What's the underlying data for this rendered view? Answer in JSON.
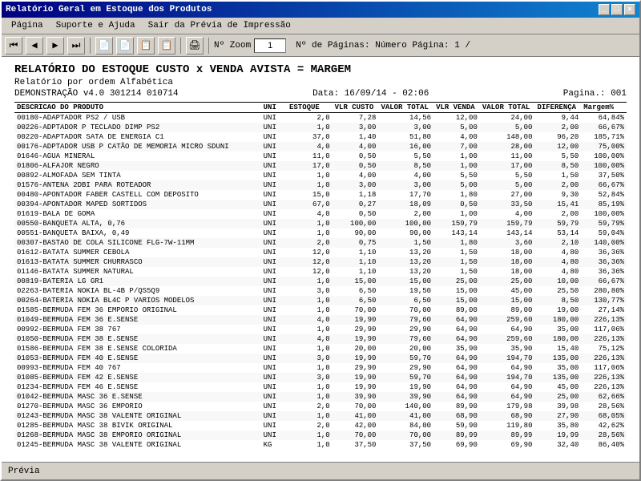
{
  "window": {
    "title": "Relatório Geral em Estoque dos Produtos"
  },
  "menu": {
    "items": [
      "Página",
      "Suporte e Ajuda",
      "Sair da Prévia de Impressão"
    ]
  },
  "toolbar": {
    "zoom_label": "Nº Zoom",
    "zoom_value": "1",
    "page_label": "Nº de Páginas: Número Página: 1 /"
  },
  "report": {
    "title": "RELATÓRIO DO ESTOQUE CUSTO x VENDA AVISTA = MARGEM",
    "subtitle": "Relatório por ordem Alfabética",
    "demo": "DEMONSTRAÇÃO v4.0 301214 010714",
    "date": "Data: 16/09/14 - 02:06",
    "page": "Pagina.: 001",
    "columns": [
      "DESCRICAO DO PRODUTO",
      "UNI",
      "ESTOQUE",
      "VLR CUSTO",
      "VALOR TOTAL",
      "VLR VENDA",
      "VALOR TOTAL",
      "DIFERENÇA",
      "Margem%"
    ],
    "rows": [
      [
        "00180-ADAPTADOR PS2 / USB",
        "UNI",
        "2,0",
        "7,28",
        "14,56",
        "12,00",
        "24,00",
        "9,44",
        "64,84%"
      ],
      [
        "00226-ADPTADOR P TECLADO DIMP PS2",
        "UNI",
        "1,0",
        "3,00",
        "3,00",
        "5,00",
        "5,00",
        "2,00",
        "66,67%"
      ],
      [
        "00220-ADAPTADOR SATA DE ENERGIA C1",
        "UNI",
        "37,0",
        "1,40",
        "51,80",
        "4,00",
        "148,00",
        "96,20",
        "185,71%"
      ],
      [
        "00176-ADPTADOR USB P CATÃO DE MEMORIA MICRO SDUNI",
        "UNI",
        "4,0",
        "4,00",
        "16,00",
        "7,00",
        "28,00",
        "12,00",
        "75,00%"
      ],
      [
        "01646-AGUA MINERAL",
        "UNI",
        "11,0",
        "0,50",
        "5,50",
        "1,00",
        "11,00",
        "5,50",
        "100,00%"
      ],
      [
        "01806-ALFAJOR NEGRO",
        "UNI",
        "17,0",
        "0,50",
        "8,50",
        "1,00",
        "17,00",
        "8,50",
        "100,00%"
      ],
      [
        "00892-ALMOFADA SEM TINTA",
        "UNI",
        "1,0",
        "4,00",
        "4,00",
        "5,50",
        "5,50",
        "1,50",
        "37,50%"
      ],
      [
        "01576-ANTENA 2DBI PARA ROTEADOR",
        "UNI",
        "1,0",
        "3,00",
        "3,00",
        "5,00",
        "5,00",
        "2,00",
        "66,67%"
      ],
      [
        "00480-APONTADOR FABER CASTELL COM DEPOSITO",
        "UNI",
        "15,0",
        "1,18",
        "17,70",
        "1,80",
        "27,00",
        "9,30",
        "52,84%"
      ],
      [
        "00394-APONTADOR MAPED SORTIDOS",
        "UNI",
        "67,0",
        "0,27",
        "18,09",
        "0,50",
        "33,50",
        "15,41",
        "85,19%"
      ],
      [
        "01619-BALA DE GOMA",
        "UNI",
        "4,0",
        "0,50",
        "2,00",
        "1,00",
        "4,00",
        "2,00",
        "100,00%"
      ],
      [
        "00550-BANQUETA ALTA, 0,76",
        "UNI",
        "1,0",
        "100,00",
        "100,00",
        "159,79",
        "159,79",
        "59,79",
        "59,79%"
      ],
      [
        "00551-BANQUETA BAIXA, 0,49",
        "UNI",
        "1,0",
        "90,00",
        "90,00",
        "143,14",
        "143,14",
        "53,14",
        "59,04%"
      ],
      [
        "00307-BASTAO DE COLA SILICONE FLG-7W-11MM",
        "UNI",
        "2,0",
        "0,75",
        "1,50",
        "1,80",
        "3,60",
        "2,10",
        "140,00%"
      ],
      [
        "01612-BATATA SUMMER CEBOLA",
        "UNI",
        "12,0",
        "1,10",
        "13,20",
        "1,50",
        "18,00",
        "4,80",
        "36,36%"
      ],
      [
        "01613-BATATA SUMMER CHURRASCO",
        "UNI",
        "12,0",
        "1,10",
        "13,20",
        "1,50",
        "18,00",
        "4,80",
        "36,36%"
      ],
      [
        "01146-BATATA SUMMER NATURAL",
        "UNI",
        "12,0",
        "1,10",
        "13,20",
        "1,50",
        "18,00",
        "4,80",
        "36,36%"
      ],
      [
        "00819-BATERIA LG GR1",
        "UNI",
        "1,0",
        "15,00",
        "15,00",
        "25,00",
        "25,00",
        "10,00",
        "66,67%"
      ],
      [
        "02263-BATERIA NOKIA BL-4B P/QS5Q9",
        "UNI",
        "3,0",
        "6,50",
        "19,50",
        "15,00",
        "45,00",
        "25,50",
        "280,80%"
      ],
      [
        "00264-BATERIA NOKIA BL4C P VARIOS MODELOS",
        "UNI",
        "1,0",
        "6,50",
        "6,50",
        "15,00",
        "15,00",
        "8,50",
        "130,77%"
      ],
      [
        "01585-BERMUDA FEM 36 EMPORIO ORIGINAL",
        "UNI",
        "1,0",
        "70,00",
        "70,00",
        "89,00",
        "89,00",
        "19,00",
        "27,14%"
      ],
      [
        "01049-BERMUDA FEM 36 E.SENSE",
        "UNI",
        "4,0",
        "19,90",
        "79,60",
        "64,90",
        "259,60",
        "180,00",
        "226,13%"
      ],
      [
        "00992-BERMUDA FEM 38  767",
        "UNI",
        "1,0",
        "29,90",
        "29,90",
        "64,90",
        "64,90",
        "35,00",
        "117,06%"
      ],
      [
        "01050-BERMUDA FEM 38 E.SENSE",
        "UNI",
        "4,0",
        "19,90",
        "79,60",
        "64,90",
        "259,60",
        "180,00",
        "226,13%"
      ],
      [
        "01586-BERMUDA FEM 38 E.SENSE COLORIDA",
        "UNI",
        "1,0",
        "20,00",
        "20,00",
        "35,90",
        "35,90",
        "15,40",
        "75,12%"
      ],
      [
        "01053-BERMUDA FEM 40 E.SENSE",
        "UNI",
        "3,0",
        "19,90",
        "59,70",
        "64,90",
        "194,70",
        "135,00",
        "226,13%"
      ],
      [
        "00993-BERMUDA FEM 40 767",
        "UNI",
        "1,0",
        "29,90",
        "29,90",
        "64,90",
        "64,90",
        "35,00",
        "117,06%"
      ],
      [
        "01085-BERMUDA FEM 42 E.SENSE",
        "UNI",
        "3,0",
        "19,90",
        "59,70",
        "64,90",
        "194,70",
        "135,00",
        "226,13%"
      ],
      [
        "01234-BERMUDA FEM 46 E.SENSE",
        "UNI",
        "1,0",
        "19,90",
        "19,90",
        "64,90",
        "64,90",
        "45,00",
        "226,13%"
      ],
      [
        "01042-BERMUDA MASC 36 E.SENSE",
        "UNI",
        "1,0",
        "39,90",
        "39,90",
        "64,90",
        "64,90",
        "25,00",
        "62,66%"
      ],
      [
        "01270-BERMUDA MASC 36 EMPORIO",
        "UNI",
        "2,0",
        "70,00",
        "140,00",
        "89,90",
        "179,98",
        "39,98",
        "28,56%"
      ],
      [
        "01243-BERMUDA MASC 38 VALENTE ORIGINAL",
        "UNI",
        "1,0",
        "41,00",
        "41,00",
        "68,90",
        "68,90",
        "27,90",
        "68,05%"
      ],
      [
        "01285-BERMUDA MASC 38 BIVIK ORIGINAL",
        "UNI",
        "2,0",
        "42,00",
        "84,00",
        "59,90",
        "119,80",
        "35,80",
        "42,62%"
      ],
      [
        "01268-BERMUDA MASC 38 EMPORIO ORIGINAL",
        "UNI",
        "1,0",
        "70,00",
        "70,00",
        "89,99",
        "89,99",
        "19,99",
        "28,56%"
      ],
      [
        "01245-BERMUDA MASC 38 VALENTE ORIGINAL",
        "KG",
        "1,0",
        "37,50",
        "37,50",
        "69,90",
        "69,90",
        "32,40",
        "86,40%"
      ]
    ]
  },
  "status": {
    "label": "Prévia"
  }
}
